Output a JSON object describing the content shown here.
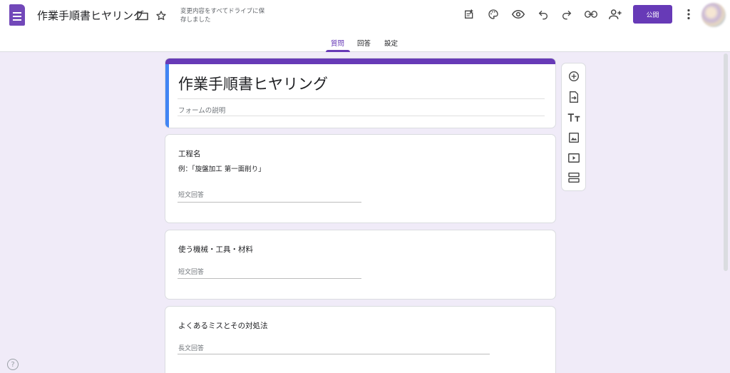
{
  "header": {
    "doc_title": "作業手順書ヒヤリング",
    "save_status": "変更内容をすべてドライブに保存しました",
    "publish_label": "公開"
  },
  "tabs": [
    {
      "label": "質問",
      "active": true
    },
    {
      "label": "回答",
      "active": false
    },
    {
      "label": "設定",
      "active": false
    }
  ],
  "form": {
    "title": "作業手順書ヒヤリング",
    "description_placeholder": "フォームの説明"
  },
  "questions": [
    {
      "title": "工程名",
      "description": "例：「旋盤加工 第一面削り」",
      "answer_placeholder": "短文回答"
    },
    {
      "title": "使う機械・工具・材料",
      "answer_placeholder": "短文回答"
    },
    {
      "title": "よくあるミスとその対処法",
      "answer_placeholder": "長文回答"
    }
  ],
  "help_glyph": "?",
  "icons": {
    "app": "google-forms-icon",
    "header": [
      "folder-icon",
      "star-icon",
      "addon-icon",
      "palette-icon",
      "eye-icon",
      "undo-icon",
      "redo-icon",
      "link-icon",
      "add-person-icon",
      "more-vert-icon"
    ],
    "sidebar": [
      "add-circle-icon",
      "import-icon",
      "title-text-icon",
      "image-icon",
      "video-icon",
      "section-icon"
    ]
  },
  "colors": {
    "accent": "#673ab7",
    "background": "#f0ebf8",
    "title_left_bar": "#4285f4"
  }
}
